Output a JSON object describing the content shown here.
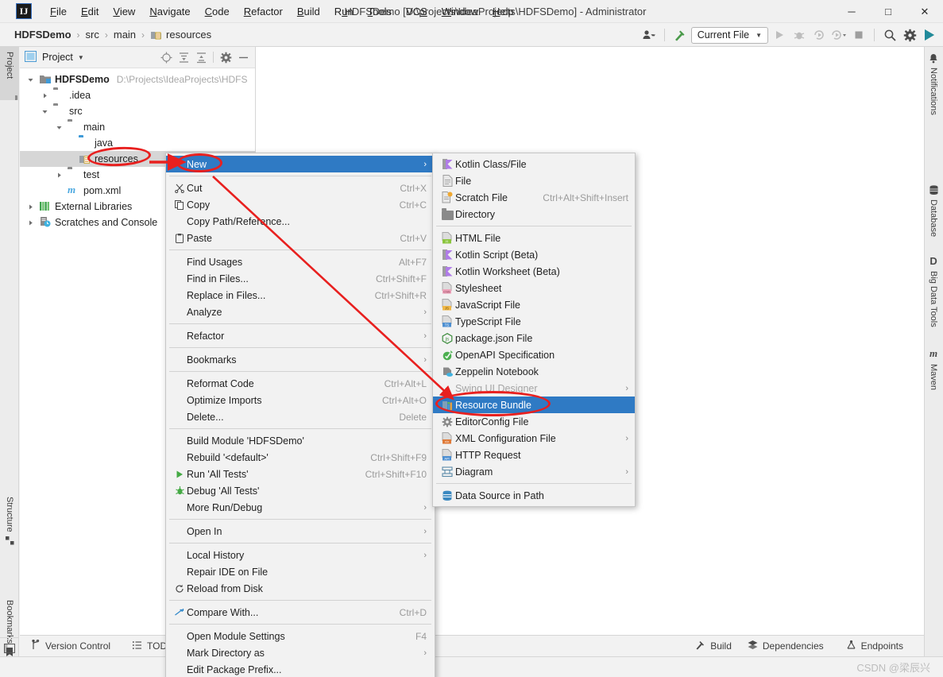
{
  "window": {
    "title": "HDFSDemo [D:\\projects\\IdeaProjects\\HDFSDemo] - Administrator",
    "logo": "IJ",
    "minimize": "─",
    "maximize": "□",
    "close": "✕"
  },
  "menubar": [
    {
      "label": "File"
    },
    {
      "label": "Edit"
    },
    {
      "label": "View"
    },
    {
      "label": "Navigate"
    },
    {
      "label": "Code"
    },
    {
      "label": "Refactor"
    },
    {
      "label": "Build"
    },
    {
      "label": "Run"
    },
    {
      "label": "Tools"
    },
    {
      "label": "VCS"
    },
    {
      "label": "Window"
    },
    {
      "label": "Help"
    }
  ],
  "navbar": {
    "breadcrumbs": [
      {
        "label": "HDFSDemo",
        "bold": true
      },
      {
        "label": "src",
        "bold": false
      },
      {
        "label": "main",
        "bold": false
      },
      {
        "label": "resources",
        "bold": false
      }
    ],
    "separator": "›",
    "run_config": "Current File",
    "run_config_caret": "▼"
  },
  "left_stripe": {
    "tabs": [
      {
        "label": "Project",
        "active": true
      },
      {
        "label": "Structure",
        "active": false
      },
      {
        "label": "Bookmarks",
        "active": false
      }
    ]
  },
  "right_stripe": {
    "tabs": [
      {
        "label": "Notifications"
      },
      {
        "label": "Database"
      },
      {
        "label": "Big Data Tools"
      },
      {
        "label": "Maven"
      }
    ]
  },
  "project_panel": {
    "title": "Project",
    "caret": "▼",
    "tree": [
      {
        "indent": 0,
        "twisty": "⌄",
        "icon": "module-icon",
        "label": "HDFSDemo",
        "bold": true,
        "path": "D:\\Projects\\IdeaProjects\\HDFS",
        "selected": false
      },
      {
        "indent": 1,
        "twisty": "›",
        "icon": "folder-icon",
        "label": ".idea",
        "bold": false,
        "path": "",
        "selected": false
      },
      {
        "indent": 1,
        "twisty": "⌄",
        "icon": "folder-icon",
        "label": "src",
        "bold": false,
        "path": "",
        "selected": false
      },
      {
        "indent": 2,
        "twisty": "⌄",
        "icon": "folder-icon",
        "label": "main",
        "bold": false,
        "path": "",
        "selected": false
      },
      {
        "indent": 3,
        "twisty": "",
        "icon": "folder-blue-icon",
        "label": "java",
        "bold": false,
        "path": "",
        "selected": false
      },
      {
        "indent": 3,
        "twisty": "",
        "icon": "resources-folder-icon",
        "label": "resources",
        "bold": false,
        "path": "",
        "selected": true
      },
      {
        "indent": 2,
        "twisty": "›",
        "icon": "folder-icon",
        "label": "test",
        "bold": false,
        "path": "",
        "selected": false
      },
      {
        "indent": 2,
        "twisty": "",
        "icon": "maven-icon",
        "label": "pom.xml",
        "bold": false,
        "path": "",
        "selected": false
      },
      {
        "indent": 0,
        "twisty": "›",
        "icon": "libraries-icon",
        "label": "External Libraries",
        "bold": false,
        "path": "",
        "selected": false
      },
      {
        "indent": 0,
        "twisty": "›",
        "icon": "scratches-icon",
        "label": "Scratches and Console",
        "bold": false,
        "path": "",
        "selected": false
      }
    ]
  },
  "context_menu": [
    {
      "type": "item",
      "icon": "",
      "label": "New",
      "mnemonic": "N",
      "key": "",
      "arrow": "›",
      "highlight": true
    },
    {
      "type": "sep"
    },
    {
      "type": "item",
      "icon": "cut-icon",
      "label": "Cut",
      "mnemonic": "t",
      "key": "Ctrl+X",
      "arrow": ""
    },
    {
      "type": "item",
      "icon": "copy-icon",
      "label": "Copy",
      "mnemonic": "C",
      "key": "Ctrl+C",
      "arrow": ""
    },
    {
      "type": "item",
      "icon": "",
      "label": "Copy Path/Reference...",
      "mnemonic": "",
      "key": "",
      "arrow": ""
    },
    {
      "type": "item",
      "icon": "paste-icon",
      "label": "Paste",
      "mnemonic": "P",
      "key": "Ctrl+V",
      "arrow": ""
    },
    {
      "type": "sep"
    },
    {
      "type": "item",
      "icon": "",
      "label": "Find Usages",
      "mnemonic": "U",
      "key": "Alt+F7",
      "arrow": ""
    },
    {
      "type": "item",
      "icon": "",
      "label": "Find in Files...",
      "mnemonic": "",
      "key": "Ctrl+Shift+F",
      "arrow": ""
    },
    {
      "type": "item",
      "icon": "",
      "label": "Replace in Files...",
      "mnemonic": "a",
      "key": "Ctrl+Shift+R",
      "arrow": ""
    },
    {
      "type": "item",
      "icon": "",
      "label": "Analyze",
      "mnemonic": "z",
      "key": "",
      "arrow": "›"
    },
    {
      "type": "sep"
    },
    {
      "type": "item",
      "icon": "",
      "label": "Refactor",
      "mnemonic": "R",
      "key": "",
      "arrow": "›"
    },
    {
      "type": "sep"
    },
    {
      "type": "item",
      "icon": "",
      "label": "Bookmarks",
      "mnemonic": "",
      "key": "",
      "arrow": "›"
    },
    {
      "type": "sep"
    },
    {
      "type": "item",
      "icon": "",
      "label": "Reformat Code",
      "mnemonic": "R",
      "key": "Ctrl+Alt+L",
      "arrow": ""
    },
    {
      "type": "item",
      "icon": "",
      "label": "Optimize Imports",
      "mnemonic": "z",
      "key": "Ctrl+Alt+O",
      "arrow": ""
    },
    {
      "type": "item",
      "icon": "",
      "label": "Delete...",
      "mnemonic": "D",
      "key": "Delete",
      "arrow": ""
    },
    {
      "type": "sep"
    },
    {
      "type": "item",
      "icon": "",
      "label": "Build Module 'HDFSDemo'",
      "mnemonic": "M",
      "key": "",
      "arrow": ""
    },
    {
      "type": "item",
      "icon": "",
      "label": "Rebuild '<default>'",
      "mnemonic": "e",
      "key": "Ctrl+Shift+F9",
      "arrow": ""
    },
    {
      "type": "item",
      "icon": "run-icon",
      "label": "Run 'All Tests'",
      "mnemonic": "u",
      "key": "Ctrl+Shift+F10",
      "arrow": ""
    },
    {
      "type": "item",
      "icon": "debug-icon",
      "label": "Debug 'All Tests'",
      "mnemonic": "D",
      "key": "",
      "arrow": ""
    },
    {
      "type": "item",
      "icon": "",
      "label": "More Run/Debug",
      "mnemonic": "",
      "key": "",
      "arrow": "›"
    },
    {
      "type": "sep"
    },
    {
      "type": "item",
      "icon": "",
      "label": "Open In",
      "mnemonic": "",
      "key": "",
      "arrow": "›"
    },
    {
      "type": "sep"
    },
    {
      "type": "item",
      "icon": "",
      "label": "Local History",
      "mnemonic": "H",
      "key": "",
      "arrow": "›"
    },
    {
      "type": "item",
      "icon": "",
      "label": "Repair IDE on File",
      "mnemonic": "",
      "key": "",
      "arrow": ""
    },
    {
      "type": "item",
      "icon": "reload-icon",
      "label": "Reload from Disk",
      "mnemonic": "",
      "key": "",
      "arrow": ""
    },
    {
      "type": "sep"
    },
    {
      "type": "item",
      "icon": "compare-icon",
      "label": "Compare With...",
      "mnemonic": "",
      "key": "Ctrl+D",
      "arrow": ""
    },
    {
      "type": "sep"
    },
    {
      "type": "item",
      "icon": "",
      "label": "Open Module Settings",
      "mnemonic": "",
      "key": "F4",
      "arrow": ""
    },
    {
      "type": "item",
      "icon": "",
      "label": "Mark Directory as",
      "mnemonic": "",
      "key": "",
      "arrow": "›"
    },
    {
      "type": "item",
      "icon": "",
      "label": "Edit Package Prefix...",
      "mnemonic": "",
      "key": "",
      "arrow": ""
    }
  ],
  "submenu": [
    {
      "type": "item",
      "icon": "kotlin-icon",
      "label": "Kotlin Class/File",
      "key": "",
      "arrow": ""
    },
    {
      "type": "item",
      "icon": "file-icon",
      "label": "File",
      "key": "",
      "arrow": ""
    },
    {
      "type": "item",
      "icon": "scratch-file-icon",
      "label": "Scratch File",
      "key": "Ctrl+Alt+Shift+Insert",
      "arrow": ""
    },
    {
      "type": "item",
      "icon": "folder-icon",
      "label": "Directory",
      "key": "",
      "arrow": ""
    },
    {
      "type": "sep"
    },
    {
      "type": "item",
      "icon": "html-file-icon",
      "label": "HTML File",
      "key": "",
      "arrow": "",
      "tag": "H",
      "tagcolor": "#8cc63f"
    },
    {
      "type": "item",
      "icon": "kotlin-icon",
      "label": "Kotlin Script (Beta)",
      "key": "",
      "arrow": ""
    },
    {
      "type": "item",
      "icon": "kotlin-icon",
      "label": "Kotlin Worksheet (Beta)",
      "key": "",
      "arrow": ""
    },
    {
      "type": "item",
      "icon": "stylesheet-icon",
      "label": "Stylesheet",
      "key": "",
      "arrow": "",
      "tag": "CSS",
      "tagcolor": "#e8a0b4"
    },
    {
      "type": "item",
      "icon": "javascript-file-icon",
      "label": "JavaScript File",
      "key": "",
      "arrow": "",
      "tag": "JS",
      "tagcolor": "#f0b849"
    },
    {
      "type": "item",
      "icon": "typescript-file-icon",
      "label": "TypeScript File",
      "key": "",
      "arrow": "",
      "tag": "TS",
      "tagcolor": "#4d8fd1"
    },
    {
      "type": "item",
      "icon": "packagejson-icon",
      "label": "package.json File",
      "key": "",
      "arrow": ""
    },
    {
      "type": "item",
      "icon": "openapi-icon",
      "label": "OpenAPI Specification",
      "key": "",
      "arrow": ""
    },
    {
      "type": "item",
      "icon": "zeppelin-icon",
      "label": "Zeppelin Notebook",
      "key": "",
      "arrow": ""
    },
    {
      "type": "item",
      "icon": "swing-icon",
      "label": "Swing UI Designer",
      "key": "",
      "arrow": "›",
      "disabled": true
    },
    {
      "type": "item",
      "icon": "resource-bundle-icon",
      "label": "Resource Bundle",
      "key": "",
      "arrow": "",
      "highlight": true
    },
    {
      "type": "item",
      "icon": "editorconfig-icon",
      "label": "EditorConfig File",
      "key": "",
      "arrow": ""
    },
    {
      "type": "item",
      "icon": "xml-config-icon",
      "label": "XML Configuration File",
      "key": "",
      "arrow": "›",
      "tag": "<>",
      "tagcolor": "#e07b39"
    },
    {
      "type": "item",
      "icon": "http-request-icon",
      "label": "HTTP Request",
      "key": "",
      "arrow": "",
      "tag": "API",
      "tagcolor": "#4d8fd1"
    },
    {
      "type": "item",
      "icon": "diagram-icon",
      "label": "Diagram",
      "key": "",
      "arrow": "›"
    },
    {
      "type": "sep"
    },
    {
      "type": "item",
      "icon": "datasource-icon",
      "label": "Data Source in Path",
      "key": "",
      "arrow": ""
    }
  ],
  "bottom_bar": {
    "left_items": [
      {
        "icon": "version-control-icon",
        "label": "Version Control"
      },
      {
        "icon": "todo-icon",
        "label": "TODO"
      }
    ],
    "right_items": [
      {
        "icon": "build-icon",
        "label": "Build"
      },
      {
        "icon": "dependencies-icon",
        "label": "Dependencies"
      },
      {
        "icon": "endpoints-icon",
        "label": "Endpoints"
      }
    ]
  },
  "watermark": "CSDN @梁辰兴",
  "colors": {
    "highlight_blue": "#2f7ac4",
    "annotation_red": "#e8201f",
    "selection_gray": "#d6d6d6",
    "menu_bg": "#f2f2f2"
  }
}
